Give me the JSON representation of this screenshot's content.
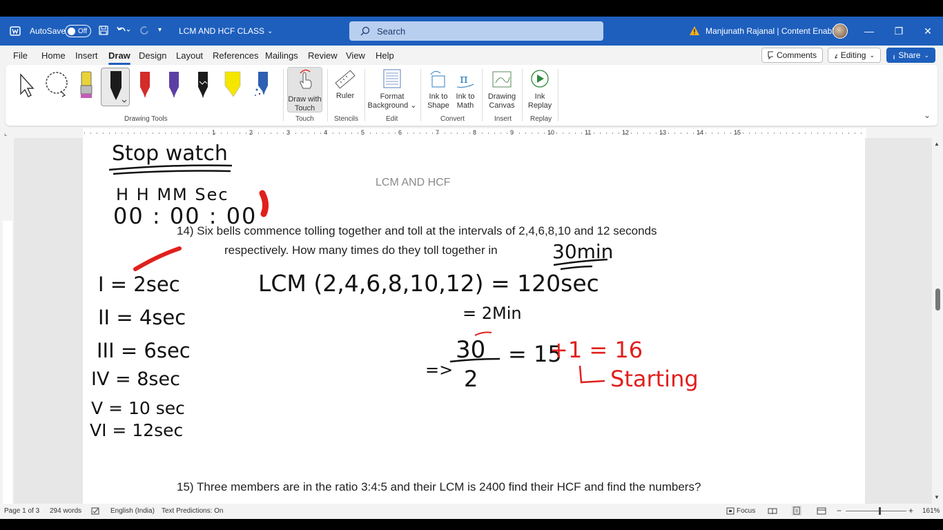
{
  "titlebar": {
    "autosave_label": "AutoSave",
    "autosave_state": "Off",
    "doc_title": "LCM AND HCF CLASS",
    "search_placeholder": "Search",
    "user_name": "Manjunath Rajanal | Content Enablers"
  },
  "menu": {
    "items": [
      "File",
      "Home",
      "Insert",
      "Draw",
      "Design",
      "Layout",
      "References",
      "Mailings",
      "Review",
      "View",
      "Help"
    ],
    "active": "Draw",
    "comments_label": "Comments",
    "editing_label": "Editing",
    "share_label": "Share"
  },
  "ribbon": {
    "drawing_tools_label": "Drawing Tools",
    "pen_colors": [
      "#e8d33a",
      "#1b1b1b",
      "#d42b2b",
      "#5b3fa3",
      "#1b1b1b",
      "#f5e600",
      "#2d5fb3"
    ],
    "draw_with_touch_line1": "Draw with",
    "draw_with_touch_line2": "Touch",
    "touch_label": "Touch",
    "ruler_label": "Ruler",
    "stencils_label": "Stencils",
    "format_bg_line1": "Format",
    "format_bg_line2": "Background",
    "edit_label": "Edit",
    "ink_shape_line1": "Ink to",
    "ink_shape_line2": "Shape",
    "ink_math_line1": "Ink to",
    "ink_math_line2": "Math",
    "convert_label": "Convert",
    "drawing_canvas_line1": "Drawing",
    "drawing_canvas_line2": "Canvas",
    "insert_label": "Insert",
    "ink_replay_line1": "Ink",
    "ink_replay_line2": "Replay",
    "replay_label": "Replay"
  },
  "ruler": {
    "numbers": [
      "1",
      "2",
      "3",
      "4",
      "5",
      "6",
      "7",
      "8",
      "9",
      "10",
      "11",
      "12",
      "13",
      "14",
      "15"
    ]
  },
  "document": {
    "header": "LCM AND HCF",
    "q14_line1": "14) Six bells commence tolling together and toll at the intervals of 2,4,6,8,10 and 12   seconds",
    "q14_line2": "respectively. How many times do they toll together in",
    "q15": "15) Three members are in the ratio 3:4:5 and their LCM is 2400 find their HCF and find the numbers?"
  },
  "handwriting": {
    "stopwatch": "Stop watch",
    "hh_mm_sec": "H H   MM  Sec",
    "time_value": "00 : 00 : 00",
    "thirty_min": "30min",
    "bell_lines": [
      "I = 2sec",
      "II = 4sec",
      "III = 6sec",
      "IV = 8sec",
      "V = 10 sec",
      "VI = 12sec"
    ],
    "lcm_line": "LCM (2,4,6,8,10,12) = 120sec",
    "two_min": "= 2Min",
    "fraction_num": "30",
    "fraction_den": "2",
    "arrow": "=>",
    "equals_15": "= 15",
    "plus_one": "+1 = 16",
    "starting": "Starting",
    "ink_color_black": "#111111",
    "ink_color_red": "#e0201c"
  },
  "status": {
    "page": "Page 1 of 3",
    "words": "294 words",
    "language": "English (India)",
    "text_predictions": "Text Predictions: On",
    "focus": "Focus",
    "zoom": "161%"
  }
}
